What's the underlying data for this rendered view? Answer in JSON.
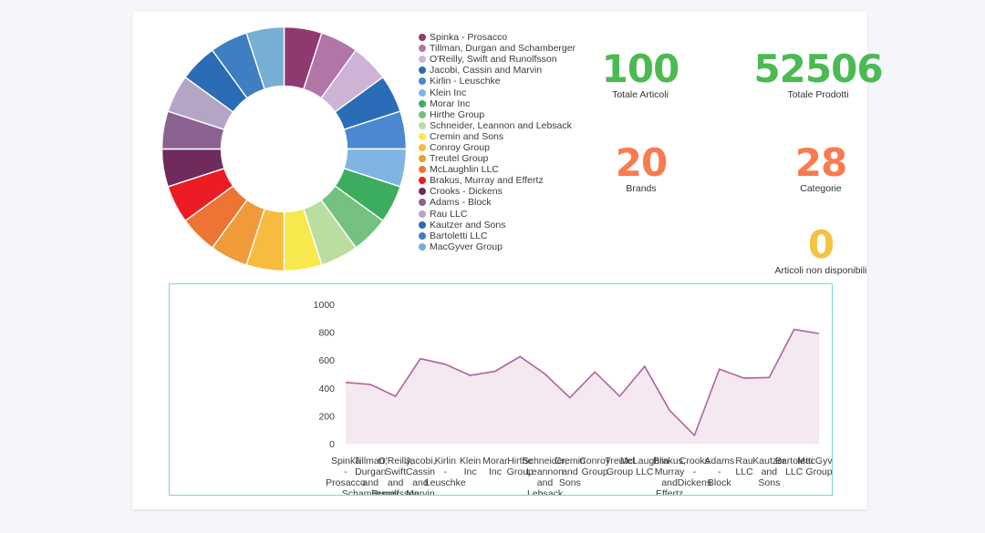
{
  "donut": {
    "segments": [
      {
        "label": "Spinka - Prosacco",
        "color": "#8e3a71",
        "value": 5
      },
      {
        "label": "Tillman, Durgan and Schamberger",
        "color": "#b275a8",
        "value": 5
      },
      {
        "label": "O'Reilly, Swift and Runolfsson",
        "color": "#cfb3d6",
        "value": 5
      },
      {
        "label": "Jacobi, Cassin and Marvin",
        "color": "#2a6cb5",
        "value": 5
      },
      {
        "label": "Kirlin - Leuschke",
        "color": "#4a89d0",
        "value": 5
      },
      {
        "label": "Klein Inc",
        "color": "#7fb4e3",
        "value": 5
      },
      {
        "label": "Morar Inc",
        "color": "#3cad5e",
        "value": 5
      },
      {
        "label": "Hirthe Group",
        "color": "#74c181",
        "value": 5
      },
      {
        "label": "Schneider, Leannon and Lebsack",
        "color": "#bade9f",
        "value": 5
      },
      {
        "label": "Cremin and Sons",
        "color": "#f7e84e",
        "value": 5
      },
      {
        "label": "Conroy Group",
        "color": "#f7bc3f",
        "value": 5
      },
      {
        "label": "Treutel Group",
        "color": "#f09a3a",
        "value": 5
      },
      {
        "label": "McLaughlin LLC",
        "color": "#ed7432",
        "value": 5
      },
      {
        "label": "Brakus, Murray and Effertz",
        "color": "#ed1c24",
        "value": 5
      },
      {
        "label": "Crooks - Dickens",
        "color": "#6e2b5c",
        "value": 5
      },
      {
        "label": "Adams - Block",
        "color": "#8c6292",
        "value": 5
      },
      {
        "label": "Rau LLC",
        "color": "#b5a5c4",
        "value": 5
      },
      {
        "label": "Kautzer and Sons",
        "color": "#2a6cb5",
        "value": 5
      },
      {
        "label": "Bartoletti LLC",
        "color": "#3d7fc1",
        "value": 5
      },
      {
        "label": "MacGyver Group",
        "color": "#76aed4",
        "value": 5
      }
    ]
  },
  "kpis": [
    {
      "key": "totale_articoli",
      "value": "100",
      "label": "Totale Articoli",
      "color": "#4cba52"
    },
    {
      "key": "totale_prodotti",
      "value": "52506",
      "label": "Totale Prodotti",
      "color": "#4cba52"
    },
    {
      "key": "brands",
      "value": "20",
      "label": "Brands",
      "color": "#f97b4f"
    },
    {
      "key": "categorie",
      "value": "28",
      "label": "Categorie",
      "color": "#f97b4f"
    },
    {
      "key": "articoli_non_disp",
      "value": "0",
      "label": "Articoli non disponibili",
      "color": "#f5c242"
    }
  ],
  "chart_data": {
    "type": "area",
    "title": "",
    "xlabel": "",
    "ylabel": "",
    "ylim": [
      0,
      1000
    ],
    "yticks": [
      0,
      200,
      400,
      600,
      800,
      1000
    ],
    "grid": false,
    "legend": "none",
    "line_color": "#b0629e",
    "fill_color": "#f4e8f1",
    "border_color": "#7ad6d0",
    "categories": [
      "Spinka - Prosacco",
      "Tillman, Durgan and Schamberger",
      "O'Reilly, Swift and Runolfsson",
      "Jacobi, Cassin and Marvin",
      "Kirlin - Leuschke",
      "Klein Inc",
      "Morar Inc",
      "Hirthe Group",
      "Schneider, Leannon and Lebsack",
      "Cremin and Sons",
      "Conroy Group",
      "Treutel Group",
      "McLaughlin LLC",
      "Brakus, Murray and Effertz",
      "Crooks - Dickens",
      "Adams - Block",
      "Rau LLC",
      "Kautzer and Sons",
      "Bartoletti LLC",
      "MacGyver Group"
    ],
    "values": [
      440,
      425,
      340,
      610,
      570,
      490,
      520,
      625,
      500,
      330,
      515,
      340,
      555,
      240,
      60,
      535,
      470,
      475,
      820,
      790
    ]
  }
}
